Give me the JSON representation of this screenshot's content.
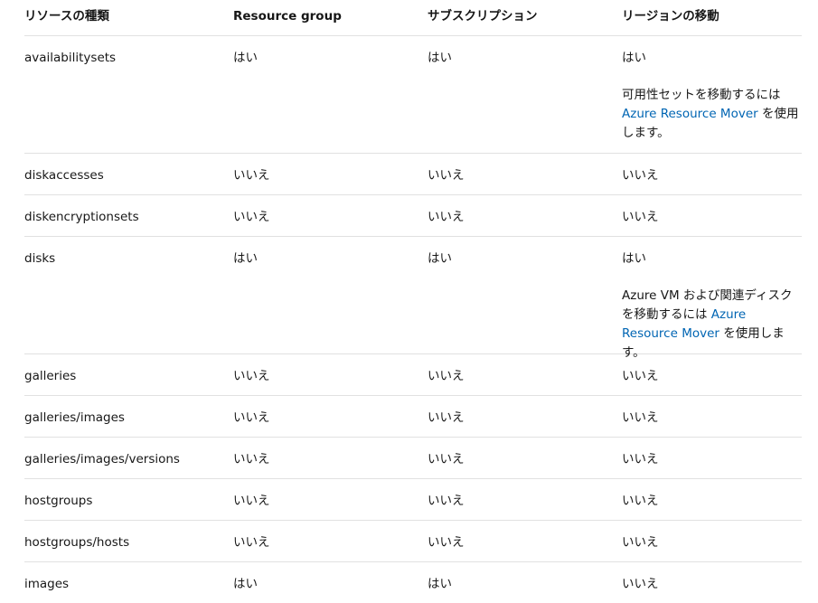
{
  "headers": {
    "resource_type": "リソースの種類",
    "resource_group": "Resource group",
    "subscription": "サブスクリプション",
    "region_move": "リージョンの移動"
  },
  "rows": [
    {
      "name": "availabilitysets",
      "rg": "はい",
      "sub": "はい",
      "region": "はい",
      "note": {
        "prefix": "可用性セットを移動するには ",
        "link": "Azure Resource Mover",
        "suffix": " を使用します。"
      }
    },
    {
      "name": "diskaccesses",
      "rg": "いいえ",
      "sub": "いいえ",
      "region": "いいえ"
    },
    {
      "name": "diskencryptionsets",
      "rg": "いいえ",
      "sub": "いいえ",
      "region": "いいえ"
    },
    {
      "name": "disks",
      "rg": "はい",
      "sub": "はい",
      "region": "はい",
      "note": {
        "prefix": "Azure VM および関連ディスクを移動するには ",
        "link": "Azure Resource Mover",
        "suffix": " を使用します。"
      }
    },
    {
      "name": "galleries",
      "rg": "いいえ",
      "sub": "いいえ",
      "region": "いいえ"
    },
    {
      "name": "galleries/images",
      "rg": "いいえ",
      "sub": "いいえ",
      "region": "いいえ"
    },
    {
      "name": "galleries/images/versions",
      "rg": "いいえ",
      "sub": "いいえ",
      "region": "いいえ"
    },
    {
      "name": "hostgroups",
      "rg": "いいえ",
      "sub": "いいえ",
      "region": "いいえ"
    },
    {
      "name": "hostgroups/hosts",
      "rg": "いいえ",
      "sub": "いいえ",
      "region": "いいえ"
    },
    {
      "name": "images",
      "rg": "はい",
      "sub": "はい",
      "region": "いいえ"
    }
  ]
}
